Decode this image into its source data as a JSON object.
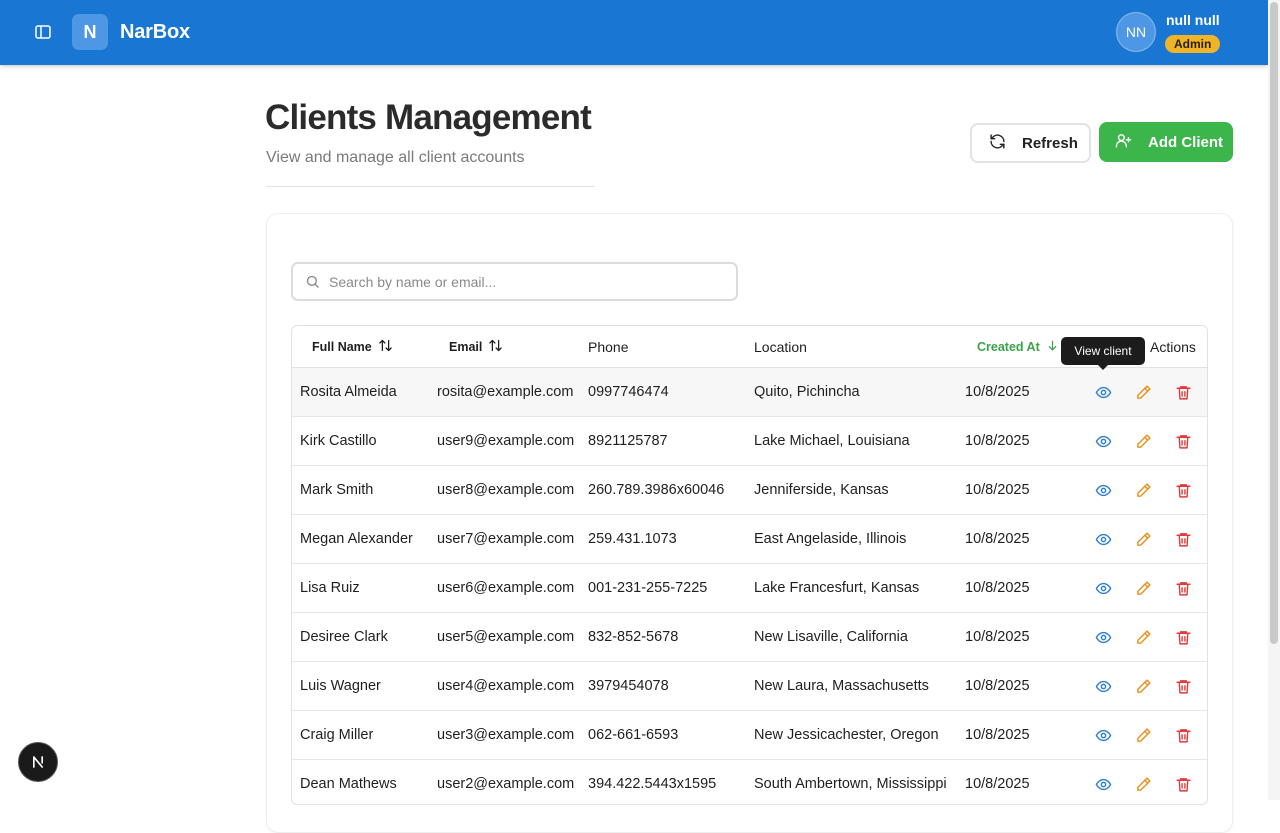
{
  "header": {
    "logo_letter": "N",
    "brand": "NarBox",
    "user": {
      "initials": "NN",
      "name": "null null",
      "role": "Admin"
    }
  },
  "page": {
    "title": "Clients Management",
    "subtitle": "View and manage all client accounts",
    "refresh_label": "Refresh",
    "add_label": "Add Client"
  },
  "search": {
    "placeholder": "Search by name or email..."
  },
  "table": {
    "columns": {
      "full_name": "Full Name",
      "email": "Email",
      "phone": "Phone",
      "location": "Location",
      "created_at": "Created At",
      "actions": "Actions"
    },
    "rows": [
      {
        "name": "Rosita Almeida",
        "email": "rosita@example.com",
        "phone": "0997746474",
        "location": "Quito, Pichincha",
        "created": "10/8/2025"
      },
      {
        "name": "Kirk Castillo",
        "email": "user9@example.com",
        "phone": "8921125787",
        "location": "Lake Michael, Louisiana",
        "created": "10/8/2025"
      },
      {
        "name": "Mark Smith",
        "email": "user8@example.com",
        "phone": "260.789.3986x60046",
        "location": "Jenniferside, Kansas",
        "created": "10/8/2025"
      },
      {
        "name": "Megan Alexander",
        "email": "user7@example.com",
        "phone": "259.431.1073",
        "location": "East Angelaside, Illinois",
        "created": "10/8/2025"
      },
      {
        "name": "Lisa Ruiz",
        "email": "user6@example.com",
        "phone": "001-231-255-7225",
        "location": "Lake Francesfurt, Kansas",
        "created": "10/8/2025"
      },
      {
        "name": "Desiree Clark",
        "email": "user5@example.com",
        "phone": "832-852-5678",
        "location": "New Lisaville, California",
        "created": "10/8/2025"
      },
      {
        "name": "Luis Wagner",
        "email": "user4@example.com",
        "phone": "3979454078",
        "location": "New Laura, Massachusetts",
        "created": "10/8/2025"
      },
      {
        "name": "Craig Miller",
        "email": "user3@example.com",
        "phone": "062-661-6593",
        "location": "New Jessicachester, Oregon",
        "created": "10/8/2025"
      },
      {
        "name": "Dean Mathews",
        "email": "user2@example.com",
        "phone": "394.422.5443x1595",
        "location": "South Ambertown, Mississippi",
        "created": "10/8/2025"
      }
    ]
  },
  "tooltip": {
    "text": "View client"
  },
  "colors": {
    "header": "#1976d2",
    "accent_green": "#3cb54a",
    "badge": "#f0b429",
    "view_icon": "#2f7fd8",
    "edit_icon": "#e8901c",
    "delete_icon": "#e23b3b"
  },
  "icons": [
    "sidebar-toggle-icon",
    "refresh-icon",
    "user-plus-icon",
    "search-icon",
    "sort-icon",
    "arrow-down-icon",
    "eye-icon",
    "pencil-icon",
    "trash-icon",
    "next-logo-icon"
  ]
}
